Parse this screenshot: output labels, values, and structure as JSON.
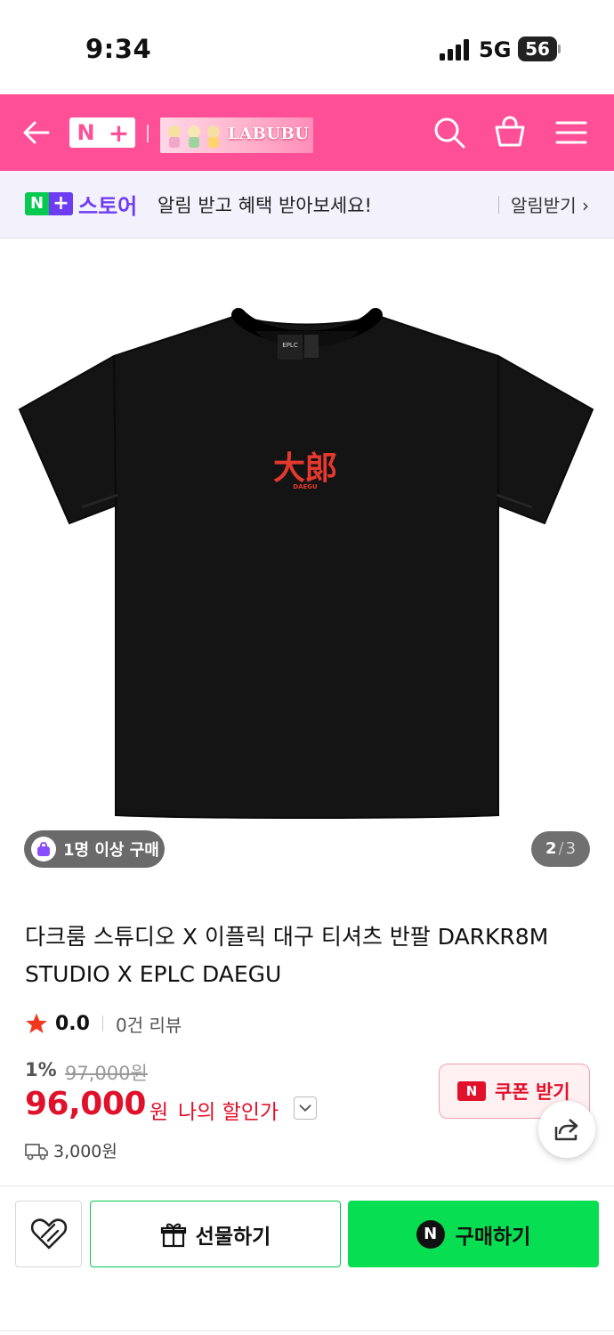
{
  "status_bar": {
    "time": "9:34",
    "network": "5G",
    "battery": "56"
  },
  "header": {
    "brand_n": "N",
    "brand_plus": "+",
    "banner_text": "LABUBU",
    "icons": [
      "back-arrow-icon",
      "search-icon",
      "cart-icon",
      "menu-icon"
    ],
    "color": "#ff4f97"
  },
  "store_bar": {
    "n": "N",
    "plus": "+",
    "store_label": "스토어",
    "message": "알림 받고 혜택 받아보세요!",
    "alert_label": "알림받기 ›"
  },
  "gallery": {
    "badge": "1명 이상 구매",
    "current": "2",
    "separator": "/",
    "total": "3",
    "shirt_print": "大郞",
    "shirt_sub": "DAEGU",
    "neck_label": "EPLC"
  },
  "product": {
    "title": "다크룸 스튜디오 X 이플릭 대구 티셔츠 반팔 DARKR8M STUDIO X EPLC DAEGU",
    "rating": "0.0",
    "reviews": "0건 리뷰",
    "discount_rate": "1%",
    "original_price": "97,000원",
    "price": "96,000",
    "currency": "원",
    "my_deal": "나의 할인가",
    "shipping_fee": "3,000원",
    "accent_color": "#e0112b"
  },
  "coupon": {
    "icon_text": "N",
    "label": "쿠폰 받기"
  },
  "actions": {
    "gift_label": "선물하기",
    "buy_icon": "N",
    "buy_label": "구매하기",
    "buy_color": "#07de52"
  }
}
